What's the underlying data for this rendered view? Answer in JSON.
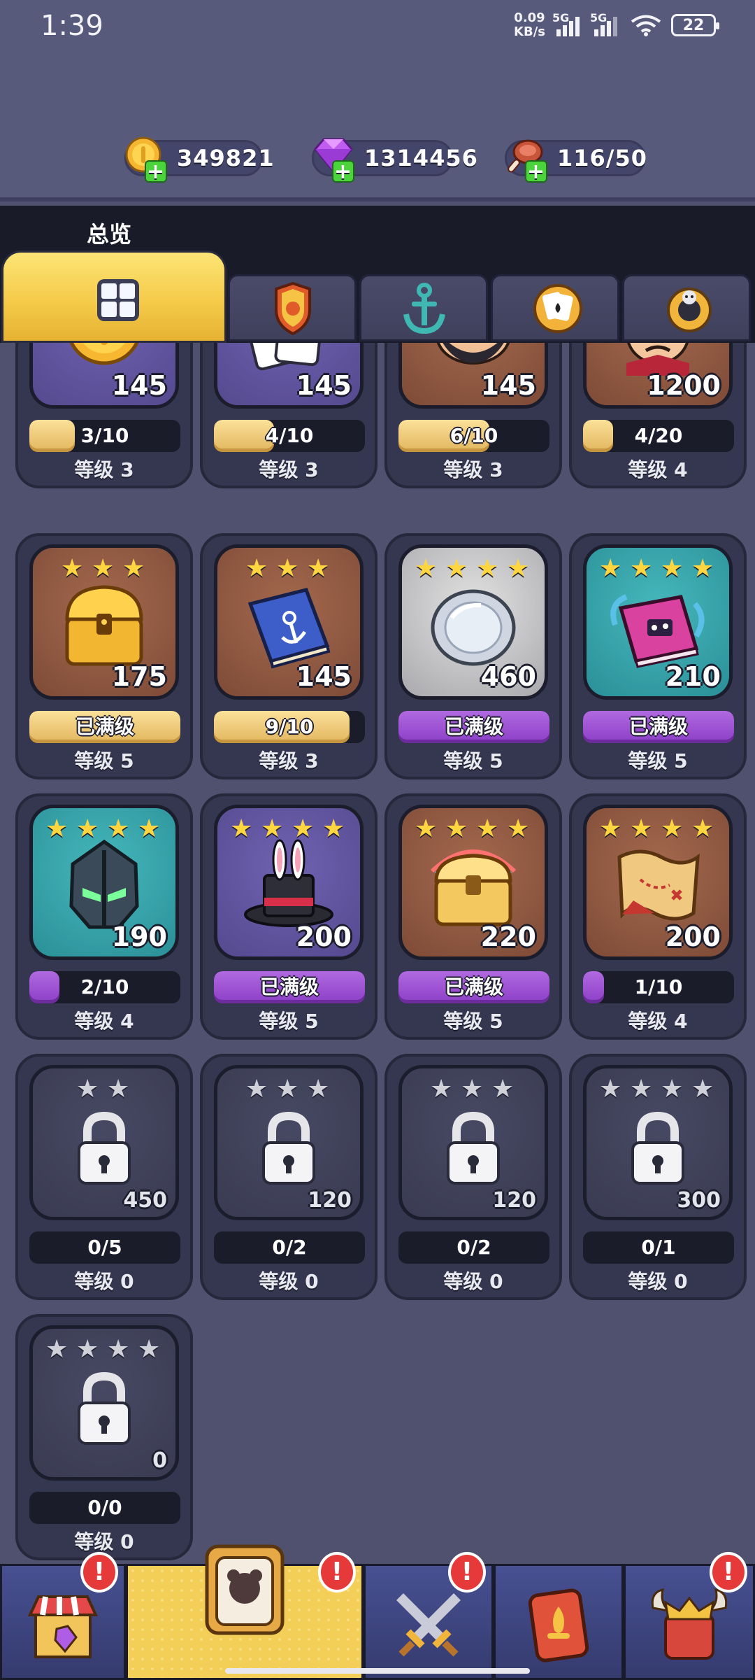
{
  "status": {
    "time": "1:39",
    "net_speed_top": "0.09",
    "net_speed_bottom": "KB/s",
    "sig1": "5G",
    "sig2": "5G",
    "battery": "22"
  },
  "currencies": {
    "coins": "349821",
    "gems": "1314456",
    "food": "116/50"
  },
  "tabs": {
    "title": "总览"
  },
  "cards": [
    {
      "cost": "145",
      "progress": "3/10",
      "fill": 0.3,
      "fill_color": "gold",
      "level": "等级 3",
      "bg": "purple",
      "art": "coin"
    },
    {
      "cost": "145",
      "progress": "4/10",
      "fill": 0.4,
      "fill_color": "gold",
      "level": "等级 3",
      "bg": "purple",
      "art": "cards"
    },
    {
      "cost": "145",
      "progress": "6/10",
      "fill": 0.6,
      "fill_color": "gold",
      "level": "等级 3",
      "bg": "brown",
      "art": "pirate"
    },
    {
      "cost": "1200",
      "progress": "4/20",
      "fill": 0.2,
      "fill_color": "gold",
      "level": "等级 4",
      "bg": "brown",
      "art": "captain"
    },
    {
      "stars": 3,
      "cost": "175",
      "progress": "已满级",
      "fill": 1,
      "fill_color": "gold",
      "level": "等级 5",
      "bg": "brown",
      "art": "chest"
    },
    {
      "stars": 3,
      "cost": "145",
      "progress": "9/10",
      "fill": 0.9,
      "fill_color": "gold",
      "level": "等级 3",
      "bg": "brown",
      "art": "book"
    },
    {
      "stars": 4,
      "cost": "460",
      "progress": "已满级",
      "fill": 1,
      "fill_color": "purple",
      "level": "等级 5",
      "bg": "grey",
      "art": "plate"
    },
    {
      "stars": 4,
      "cost": "210",
      "progress": "已满级",
      "fill": 1,
      "fill_color": "purple",
      "level": "等级 5",
      "bg": "teal",
      "art": "tome"
    },
    {
      "stars": 4,
      "cost": "190",
      "progress": "2/10",
      "fill": 0.2,
      "fill_color": "purple",
      "level": "等级 4",
      "bg": "teal",
      "art": "helmet"
    },
    {
      "stars": 4,
      "cost": "200",
      "progress": "已满级",
      "fill": 1,
      "fill_color": "purple",
      "level": "等级 5",
      "bg": "purple",
      "art": "hat"
    },
    {
      "stars": 4,
      "cost": "220",
      "progress": "已满级",
      "fill": 1,
      "fill_color": "purple",
      "level": "等级 5",
      "bg": "brown",
      "art": "goldchest"
    },
    {
      "stars": 4,
      "cost": "200",
      "progress": "1/10",
      "fill": 0.1,
      "fill_color": "purple",
      "level": "等级 4",
      "bg": "brown",
      "art": "map"
    },
    {
      "stars": 2,
      "cost": "450",
      "progress": "0/5",
      "fill": 0,
      "level": "等级 0",
      "bg": "locked",
      "art": "lock"
    },
    {
      "stars": 3,
      "cost": "120",
      "progress": "0/2",
      "fill": 0,
      "level": "等级 0",
      "bg": "locked",
      "art": "lock"
    },
    {
      "stars": 3,
      "cost": "120",
      "progress": "0/2",
      "fill": 0,
      "level": "等级 0",
      "bg": "locked",
      "art": "lock"
    },
    {
      "stars": 4,
      "cost": "300",
      "progress": "0/1",
      "fill": 0,
      "level": "等级 0",
      "bg": "locked",
      "art": "lock"
    },
    {
      "stars": 4,
      "cost": "0",
      "progress": "0/0",
      "fill": 0,
      "level": "等级 0",
      "bg": "locked",
      "art": "lock"
    }
  ],
  "nav": {
    "alert": "!"
  }
}
